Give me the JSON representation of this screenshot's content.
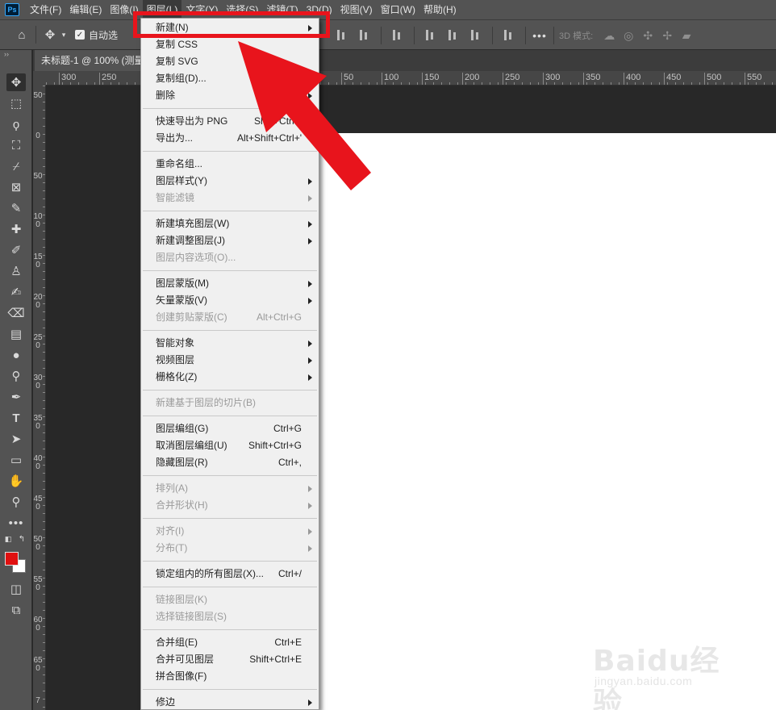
{
  "app": {
    "logo": "Ps"
  },
  "menubar": {
    "items": [
      "文件(F)",
      "编辑(E)",
      "图像(I)",
      "图层(L)",
      "文字(Y)",
      "选择(S)",
      "滤镜(T)",
      "3D(D)",
      "视图(V)",
      "窗口(W)",
      "帮助(H)"
    ],
    "active_index": 3
  },
  "options_bar": {
    "auto_select_label": "自动选",
    "auto_select_checked": true,
    "mode_3d_label": "3D 模式:"
  },
  "document": {
    "tab_title": "未标题-1 @ 100% (测量"
  },
  "ruler_h": {
    "labels": [
      "300",
      "250",
      "50",
      "100",
      "150",
      "200",
      "250",
      "300",
      "350",
      "400",
      "450",
      "500",
      "550"
    ]
  },
  "ruler_v": {
    "labels": [
      "50",
      "0",
      "50",
      "100",
      "150",
      "200",
      "250",
      "300",
      "350",
      "400",
      "450",
      "500",
      "550",
      "600",
      "650",
      "7"
    ]
  },
  "tools": [
    "move-tool",
    "marquee-tool",
    "lasso-tool",
    "object-select-tool",
    "crop-tool",
    "frame-tool",
    "eyedropper-tool",
    "healing-tool",
    "brush-tool",
    "stamp-tool",
    "history-brush-tool",
    "eraser-tool",
    "gradient-tool",
    "blur-tool",
    "dodge-tool",
    "pen-tool",
    "type-tool",
    "path-select-tool",
    "rectangle-tool",
    "hand-tool",
    "zoom-tool",
    "more-tools"
  ],
  "colors": {
    "foreground": "#e01010",
    "background": "#ffffff",
    "highlight": "#e8141c"
  },
  "layer_menu": {
    "groups": [
      [
        {
          "label": "新建(N)",
          "submenu": true
        },
        {
          "label": "复制 CSS"
        },
        {
          "label": "复制 SVG"
        },
        {
          "label": "复制组(D)..."
        },
        {
          "label": "删除",
          "submenu": true
        }
      ],
      [
        {
          "label": "快速导出为 PNG",
          "shortcut": "Shift+Ctrl+'"
        },
        {
          "label": "导出为...",
          "shortcut": "Alt+Shift+Ctrl+'"
        }
      ],
      [
        {
          "label": "重命名组..."
        },
        {
          "label": "图层样式(Y)",
          "submenu": true
        },
        {
          "label": "智能滤镜",
          "submenu": true,
          "disabled": true
        }
      ],
      [
        {
          "label": "新建填充图层(W)",
          "submenu": true
        },
        {
          "label": "新建调整图层(J)",
          "submenu": true
        },
        {
          "label": "图层内容选项(O)...",
          "disabled": true
        }
      ],
      [
        {
          "label": "图层蒙版(M)",
          "submenu": true
        },
        {
          "label": "矢量蒙版(V)",
          "submenu": true
        },
        {
          "label": "创建剪贴蒙版(C)",
          "shortcut": "Alt+Ctrl+G",
          "disabled": true
        }
      ],
      [
        {
          "label": "智能对象",
          "submenu": true
        },
        {
          "label": "视频图层",
          "submenu": true
        },
        {
          "label": "栅格化(Z)",
          "submenu": true
        }
      ],
      [
        {
          "label": "新建基于图层的切片(B)",
          "disabled": true
        }
      ],
      [
        {
          "label": "图层编组(G)",
          "shortcut": "Ctrl+G"
        },
        {
          "label": "取消图层编组(U)",
          "shortcut": "Shift+Ctrl+G"
        },
        {
          "label": "隐藏图层(R)",
          "shortcut": "Ctrl+,"
        }
      ],
      [
        {
          "label": "排列(A)",
          "submenu": true,
          "disabled": true
        },
        {
          "label": "合并形状(H)",
          "submenu": true,
          "disabled": true
        }
      ],
      [
        {
          "label": "对齐(I)",
          "submenu": true,
          "disabled": true
        },
        {
          "label": "分布(T)",
          "submenu": true,
          "disabled": true
        }
      ],
      [
        {
          "label": "锁定组内的所有图层(X)...",
          "shortcut": "Ctrl+/"
        }
      ],
      [
        {
          "label": "链接图层(K)",
          "disabled": true
        },
        {
          "label": "选择链接图层(S)",
          "disabled": true
        }
      ],
      [
        {
          "label": "合并组(E)",
          "shortcut": "Ctrl+E"
        },
        {
          "label": "合并可见图层",
          "shortcut": "Shift+Ctrl+E"
        },
        {
          "label": "拼合图像(F)"
        }
      ],
      [
        {
          "label": "修边",
          "submenu": true
        }
      ]
    ]
  },
  "watermark": {
    "brand": "Baidu经验",
    "url": "jingyan.baidu.com"
  }
}
